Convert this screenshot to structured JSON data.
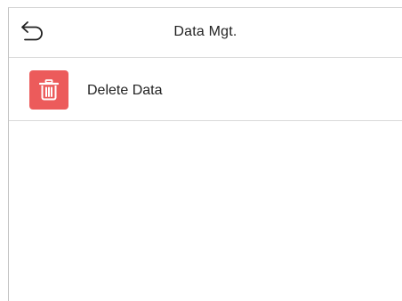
{
  "header": {
    "back_icon": "back-arrow-icon",
    "title": "Data Mgt."
  },
  "menu": {
    "items": [
      {
        "label": "Delete Data",
        "icon": "trash-icon",
        "icon_bg_color": "#ec5b5b"
      }
    ]
  },
  "colors": {
    "divider": "#d9d9d9",
    "text": "#222222",
    "background": "#ffffff"
  }
}
